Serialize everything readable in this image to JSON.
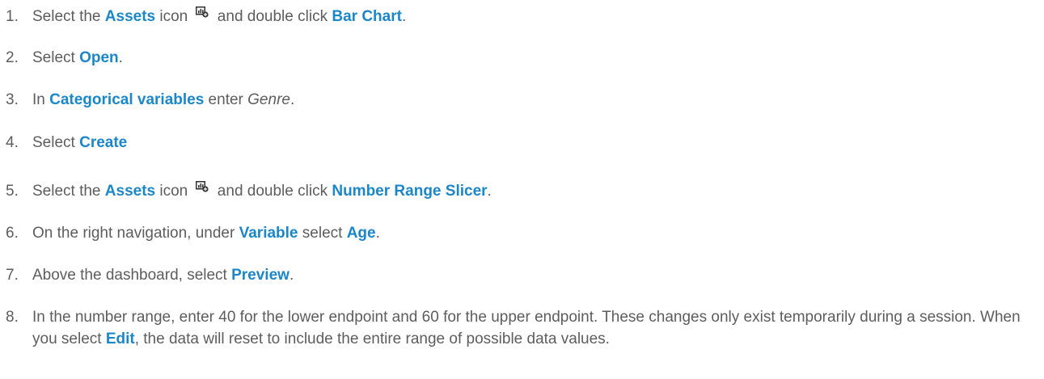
{
  "steps": [
    {
      "number": "1.",
      "t1": "Select the ",
      "assets": "Assets",
      "t2": " icon ",
      "icon": "assets-add-icon",
      "t3": " and double click ",
      "target": "Bar Chart",
      "t4": "."
    },
    {
      "number": "2.",
      "t1": "Select ",
      "target": "Open",
      "t2": "."
    },
    {
      "number": "3.",
      "t1": "In ",
      "target": "Categorical variables",
      "t2": " enter ",
      "value": "Genre",
      "t3": "."
    },
    {
      "number": "4.",
      "t1": "Select ",
      "target": "Create"
    },
    {
      "number": "5.",
      "t1": "Select the ",
      "assets": "Assets",
      "t2": " icon ",
      "icon": "assets-add-icon",
      "t3": " and double click ",
      "target": "Number Range Slicer",
      "t4": "."
    },
    {
      "number": "6.",
      "t1": "On the right navigation, under ",
      "target1": "Variable",
      "t2": " select ",
      "target2": "Age",
      "t3": "."
    },
    {
      "number": "7.",
      "t1": "Above the dashboard, select ",
      "target": "Preview",
      "t2": "."
    },
    {
      "number": "8.",
      "t1": "In the number range, enter 40 for the lower endpoint and 60 for the upper endpoint. These changes only exist temporarily during a session. When you select ",
      "target": "Edit",
      "t2": ", the data will reset to include the entire range of possible data values."
    }
  ],
  "colors": {
    "text": "#5d5d5d",
    "highlight": "#1b87c8"
  }
}
